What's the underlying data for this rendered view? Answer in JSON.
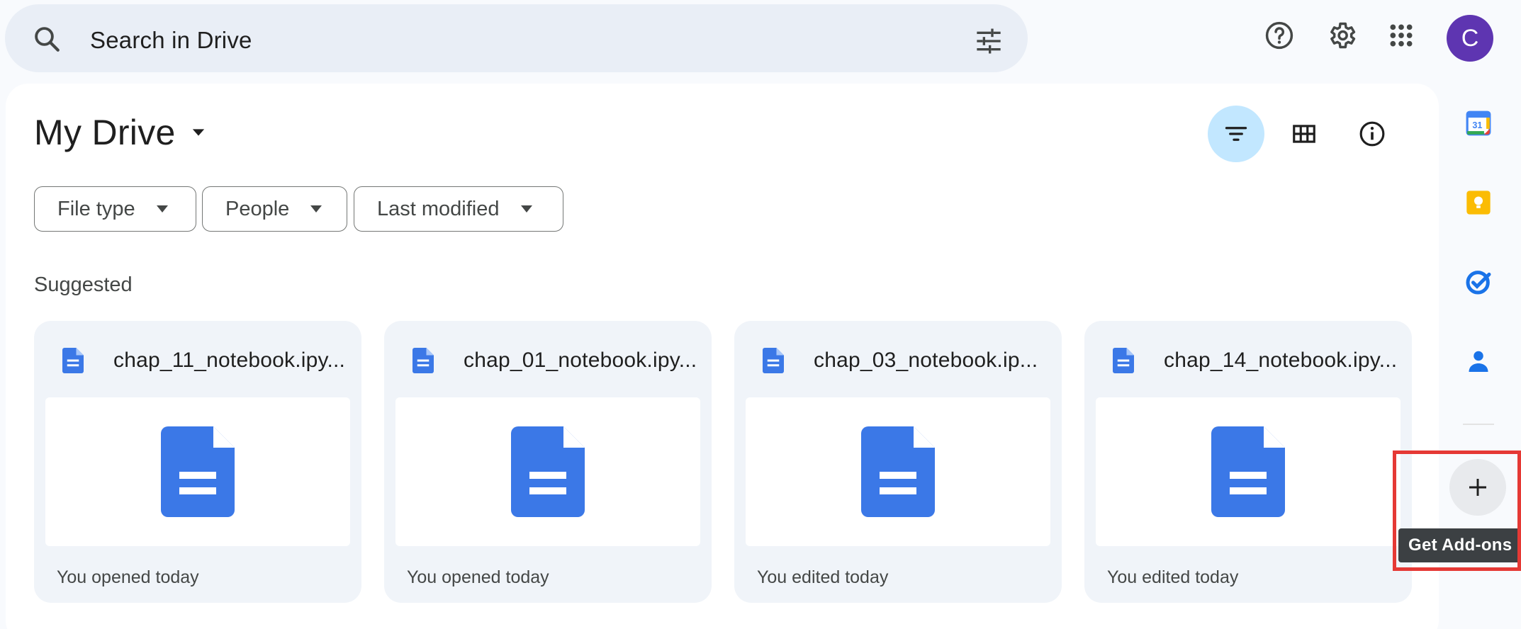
{
  "search": {
    "placeholder": "Search in Drive",
    "icon": "search-icon",
    "options_icon": "tune-icon"
  },
  "header": {
    "icons": [
      "help-icon",
      "settings-icon",
      "apps-grid-icon"
    ],
    "avatar_letter": "C",
    "avatar_color": "#5e35b1"
  },
  "main": {
    "title": "My Drive",
    "view_controls": [
      "filter-list-icon",
      "grid-view-icon",
      "info-icon"
    ],
    "filters": [
      {
        "label": "File type"
      },
      {
        "label": "People"
      },
      {
        "label": "Last modified"
      }
    ],
    "section_label": "Suggested",
    "cards": [
      {
        "title": "chap_11_notebook.ipy...",
        "meta": "You opened today"
      },
      {
        "title": "chap_01_notebook.ipy...",
        "meta": "You opened today"
      },
      {
        "title": "chap_03_notebook.ip...",
        "meta": "You edited today"
      },
      {
        "title": "chap_14_notebook.ipy...",
        "meta": "You edited today"
      }
    ]
  },
  "side_panel": {
    "apps": [
      "calendar-icon",
      "keep-icon",
      "tasks-icon",
      "contacts-icon"
    ],
    "calendar_day": "31",
    "addon_tooltip": "Get Add-ons"
  },
  "colors": {
    "accent": "#0b57d0",
    "doc_blue": "#3b78e7",
    "active_chip": "#c2e7ff",
    "highlight": "#e53935"
  }
}
